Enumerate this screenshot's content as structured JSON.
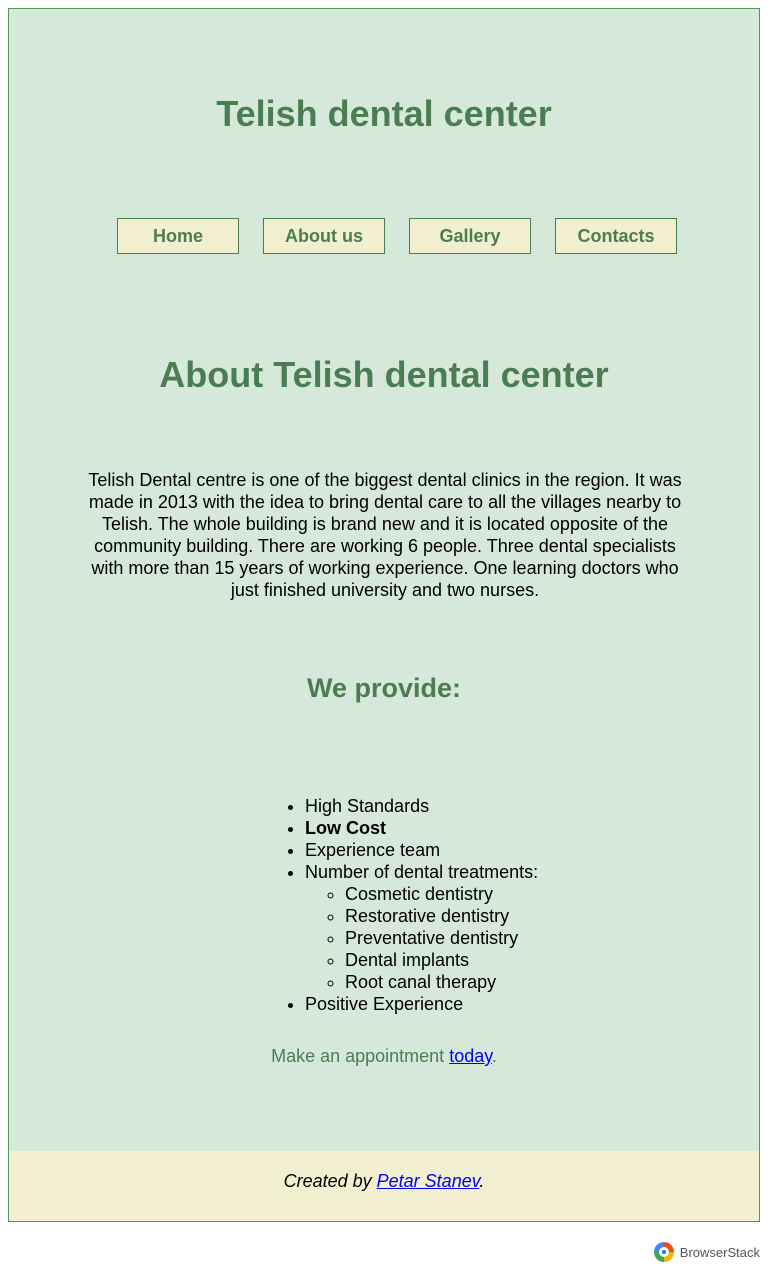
{
  "header": {
    "title": "Telish dental center"
  },
  "nav": {
    "items": [
      "Home",
      "About us",
      "Gallery",
      "Contacts"
    ]
  },
  "about": {
    "title": "About Telish dental center",
    "text": "Telish Dental centre is one of the biggest dental clinics in the region. It was made in 2013 with the idea to bring dental care to all the villages nearby to Telish. The whole building is brand new and it is located opposite of the community building. There are working 6 people. Three dental specialists with more than 15 years of working experience. One learning doctors who just finished university and two nurses."
  },
  "provide": {
    "title": "We provide:",
    "items": [
      "High Standards",
      "Low Cost",
      "Experience team",
      "Number of dental treatments:",
      "Positive Experience"
    ],
    "treatments": [
      "Cosmetic dentistry",
      "Restorative dentistry",
      "Preventative dentistry",
      "Dental implants",
      "Root canal therapy"
    ]
  },
  "appointment": {
    "prefix": "Make an appointment ",
    "link": "today",
    "suffix": "."
  },
  "footer": {
    "prefix": "Created by ",
    "author": "Petar Stanev",
    "suffix": "."
  },
  "badge": {
    "text": "BrowserStack",
    "icon": "browserstack-logo-icon"
  },
  "colors": {
    "accent": "#4b7d53",
    "background": "#d6e8da",
    "button": "#f1efd0",
    "link": "#0000ee"
  }
}
